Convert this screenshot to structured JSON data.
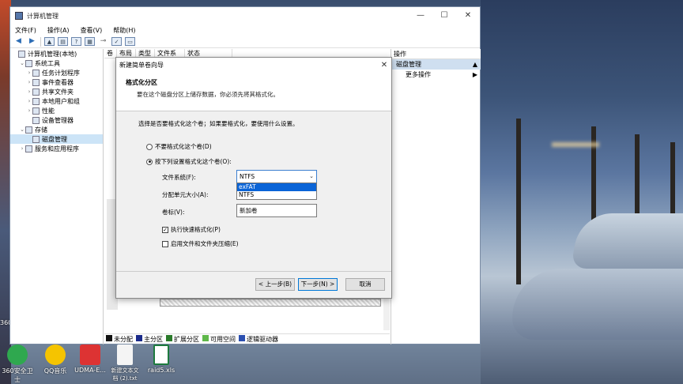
{
  "window": {
    "title": "计算机管理",
    "controls": [
      "—",
      "☐",
      "✕"
    ],
    "menu": [
      "文件(F)",
      "操作(A)",
      "查看(V)",
      "帮助(H)"
    ]
  },
  "tree": {
    "nodes": [
      {
        "label": "计算机管理(本地)",
        "indent": 0,
        "exp": "",
        "selected": false
      },
      {
        "label": "系统工具",
        "indent": 1,
        "exp": "⌄",
        "selected": false
      },
      {
        "label": "任务计划程序",
        "indent": 2,
        "exp": "›",
        "selected": false
      },
      {
        "label": "事件查看器",
        "indent": 2,
        "exp": "›",
        "selected": false
      },
      {
        "label": "共享文件夹",
        "indent": 2,
        "exp": "›",
        "selected": false
      },
      {
        "label": "本地用户和组",
        "indent": 2,
        "exp": "›",
        "selected": false
      },
      {
        "label": "性能",
        "indent": 2,
        "exp": "›",
        "selected": false
      },
      {
        "label": "设备管理器",
        "indent": 2,
        "exp": "",
        "selected": false
      },
      {
        "label": "存储",
        "indent": 1,
        "exp": "⌄",
        "selected": false
      },
      {
        "label": "磁盘管理",
        "indent": 2,
        "exp": "",
        "selected": true
      },
      {
        "label": "服务和应用程序",
        "indent": 1,
        "exp": "›",
        "selected": false
      }
    ]
  },
  "center": {
    "columns": [
      "卷",
      "布局",
      "类型",
      "文件系统",
      "状态"
    ],
    "legend": [
      {
        "label": "未分配",
        "color": "#111111"
      },
      {
        "label": "主分区",
        "color": "#1a2a8a"
      },
      {
        "label": "扩展分区",
        "color": "#2a7a2a"
      },
      {
        "label": "可用空间",
        "color": "#5fb84a"
      },
      {
        "label": "逻辑驱动器",
        "color": "#2b4fb0"
      }
    ]
  },
  "actions": {
    "header": "操作",
    "selected": "磁盘管理",
    "items": [
      "更多操作"
    ]
  },
  "dialog": {
    "title": "新建简单卷向导",
    "heading": "格式化分区",
    "subheading": "要在这个磁盘分区上储存数据，你必须先将其格式化。",
    "question": "选择是否要格式化这个卷；如果要格式化，要使用什么设置。",
    "radio_no_format": "不要格式化这个卷(D)",
    "radio_format": "按下列设置格式化这个卷(O):",
    "fs_label": "文件系统(F):",
    "fs_value": "NTFS",
    "fs_options": [
      "exFAT",
      "NTFS"
    ],
    "alloc_label": "分配单元大小(A):",
    "volume_label": "卷标(V):",
    "volume_value": "新加卷",
    "quick_format": "执行快速格式化(P)",
    "compress": "启用文件和文件夹压缩(E)",
    "btn_back": "< 上一步(B)",
    "btn_next": "下一步(N) >",
    "btn_cancel": "取消"
  },
  "desktop": {
    "icons": [
      "360安全卫士",
      "QQ音乐",
      "UDMA-E...",
      "新建文本文档 (2).txt",
      "raid5.xls"
    ],
    "left_labels": [
      "360"
    ]
  }
}
